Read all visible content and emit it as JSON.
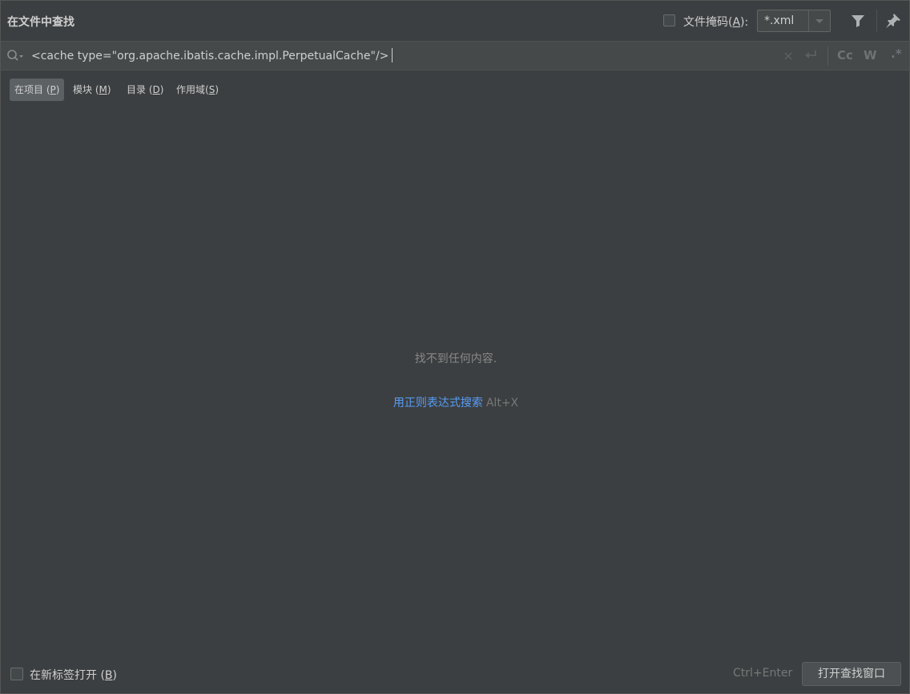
{
  "dialog": {
    "title": "在文件中查找"
  },
  "file_mask": {
    "label_prefix": "文件掩码(",
    "mnemonic": "A",
    "label_suffix": "):",
    "checked": false,
    "value": "*.xml"
  },
  "icons": {
    "filter": "filter-icon",
    "pin": "pin-icon",
    "search": "search-icon",
    "clear": "close-icon",
    "newline": "newline-icon"
  },
  "search": {
    "query": "<cache type=\"org.apache.ibatis.cache.impl.PerpetualCache\"/>",
    "match_case": "Cc",
    "words": "W",
    "regex": ".*"
  },
  "scopes": [
    {
      "label": "在项目 (",
      "mnemonic": "P",
      "suffix": ")",
      "selected": true
    },
    {
      "label": "模块 (",
      "mnemonic": "M",
      "suffix": ")",
      "selected": false
    },
    {
      "label": "目录 (",
      "mnemonic": "D",
      "suffix": ")",
      "selected": false
    },
    {
      "label": "作用域(",
      "mnemonic": "S",
      "suffix": ")",
      "selected": false
    }
  ],
  "results": {
    "empty_message": "找不到任何内容.",
    "regex_link": "用正则表达式搜索",
    "regex_shortcut": "Alt+X"
  },
  "footer": {
    "new_tab_prefix": "在新标签打开 (",
    "new_tab_mnemonic": "B",
    "new_tab_suffix": ")",
    "new_tab_checked": false,
    "shortcut": "Ctrl+Enter",
    "open_button": "打开查找窗口"
  },
  "colors": {
    "background": "#3c3f41",
    "link": "#589df6",
    "selected_tab": "#5c6164"
  }
}
